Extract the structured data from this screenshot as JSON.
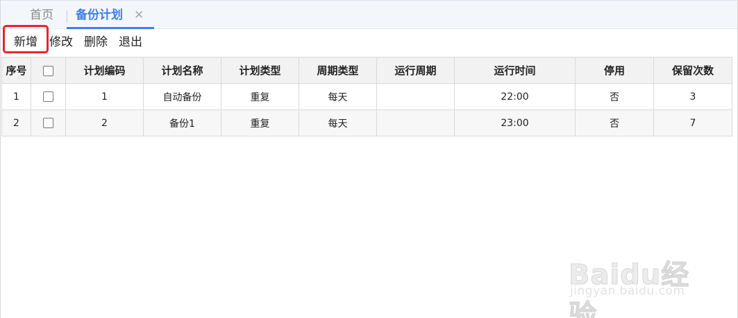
{
  "tabs": {
    "home_label": "首页",
    "active_label": "备份计划",
    "close_glyph": "✕"
  },
  "toolbar": {
    "add_label": "新增",
    "edit_label": "修改",
    "delete_label": "删除",
    "exit_label": "退出"
  },
  "table": {
    "headers": {
      "seq": "序号",
      "plan_code": "计划编码",
      "plan_name": "计划名称",
      "plan_type": "计划类型",
      "cycle_type": "周期类型",
      "run_cycle": "运行周期",
      "run_time": "运行时间",
      "disabled": "停用",
      "retain_count": "保留次数"
    },
    "rows": [
      {
        "seq": "1",
        "plan_code": "1",
        "plan_name": "自动备份",
        "plan_type": "重复",
        "cycle_type": "每天",
        "run_cycle": "",
        "run_time": "22:00",
        "disabled": "否",
        "retain_count": "3",
        "checked": false
      },
      {
        "seq": "2",
        "plan_code": "2",
        "plan_name": "备份1",
        "plan_type": "重复",
        "cycle_type": "每天",
        "run_cycle": "",
        "run_time": "23:00",
        "disabled": "否",
        "retain_count": "7",
        "checked": false
      }
    ]
  },
  "watermark": {
    "logo_text": "Baidu经验",
    "url_text": "jingyan.baidu.com"
  },
  "colors": {
    "accent": "#3d7fe6",
    "highlight_border": "#e8242a",
    "header_bg": "#f2f2f2"
  }
}
